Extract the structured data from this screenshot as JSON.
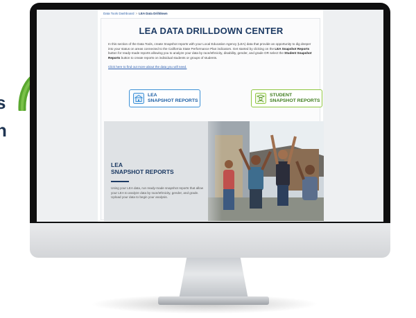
{
  "side_text": [
    "s",
    "n"
  ],
  "colors": {
    "accent_blue": "#1c3a63",
    "lea_button": "#3a8fd6",
    "student_button": "#8ec63f",
    "arrow_green": "#5aa830"
  },
  "breadcrumb": {
    "root": "Data Tools Dashboard",
    "separator": ">",
    "current": "LEA Data Drilldown"
  },
  "page": {
    "title": "LEA DATA DRILLDOWN CENTER",
    "intro_part1": "In this section of the Data Tools, create Snapshot reports with your Local Education Agency (LEA) data that provide an opportunity to dig deeper into your status on areas connected to the California State Performance Plan indicators. Get started by clicking on the ",
    "intro_bold1": "LEA Snapshot Reports",
    "intro_part2": " button for ready-made reports allowing you to analyze your data by race/ethnicity, disability, gender, and grade OR select the ",
    "intro_bold2": "Student Snapshot Reports",
    "intro_part3": " button to create reports on individual students or groups of students.",
    "more_link": "Click here to find out more about the data you will need."
  },
  "buttons": {
    "lea_line1": "LEA",
    "lea_line2": "SNAPSHOT REPORTS",
    "lea_icon": "school-icon",
    "student_line1": "STUDENT",
    "student_line2": "SNAPSHOT REPORTS",
    "student_icon": "student-icon"
  },
  "hero": {
    "title_line1": "LEA",
    "title_line2": "SNAPSHOT REPORTS",
    "description": "Using your LEA data, run ready-made snapshot reports that allow your LEA to analyze data by race/ethnicity, gender, and grade. Upload your data to begin your analysis."
  }
}
